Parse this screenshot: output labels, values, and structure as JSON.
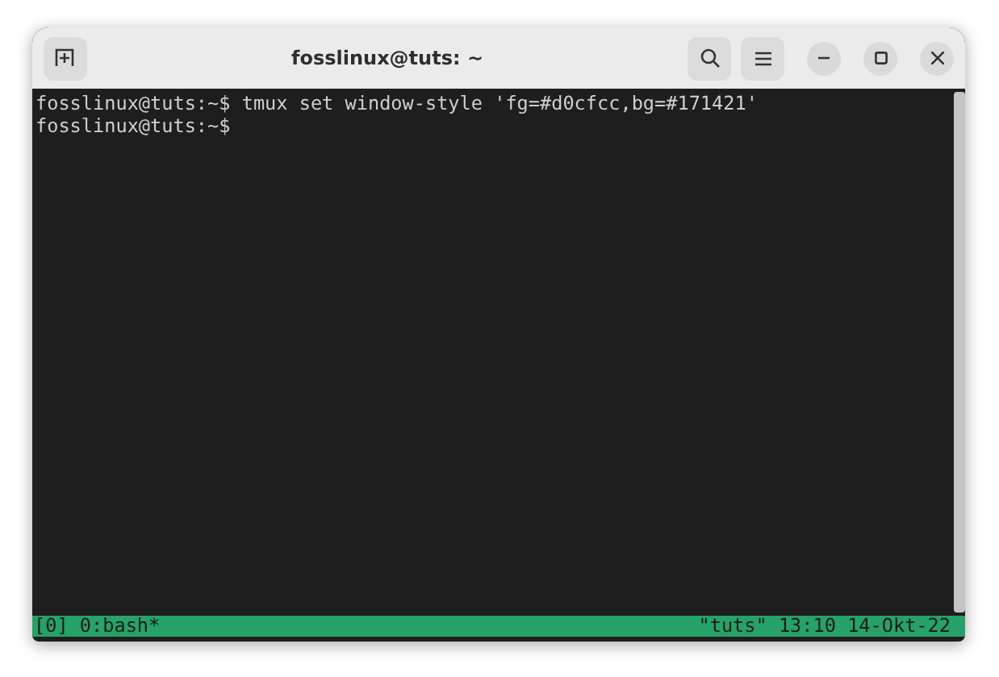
{
  "window": {
    "title": "fosslinux@tuts: ~"
  },
  "terminal": {
    "lines": [
      {
        "prompt": "fosslinux@tuts:~$",
        "command": "tmux set window-style 'fg=#d0cfcc,bg=#171421'"
      },
      {
        "prompt": "fosslinux@tuts:~$"
      }
    ]
  },
  "status_bar": {
    "left": "[0] 0:bash*",
    "right": "\"tuts\" 13:10 14-Okt-22"
  }
}
